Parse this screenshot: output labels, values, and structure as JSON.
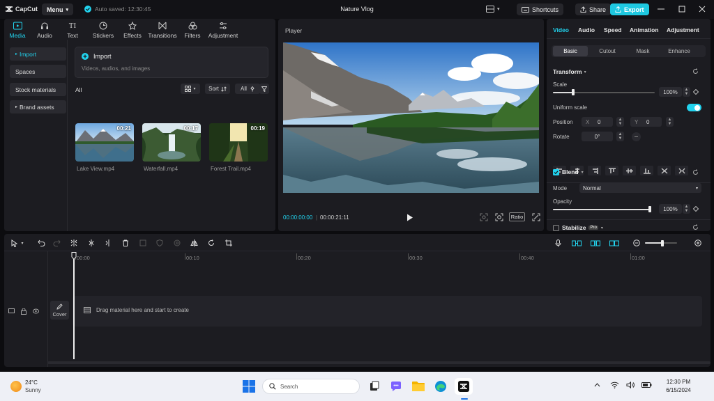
{
  "app": {
    "name": "CapCut",
    "menu_label": "Menu",
    "autosave": "Auto saved: 12:30:45",
    "project_title": "Nature Vlog",
    "shortcuts": "Shortcuts",
    "share": "Share",
    "export": "Export"
  },
  "media_tabs": [
    {
      "label": "Media",
      "icon": "media-icon"
    },
    {
      "label": "Audio",
      "icon": "audio-icon"
    },
    {
      "label": "Text",
      "icon": "text-icon"
    },
    {
      "label": "Stickers",
      "icon": "stickers-icon"
    },
    {
      "label": "Effects",
      "icon": "effects-icon"
    },
    {
      "label": "Transitions",
      "icon": "transitions-icon"
    },
    {
      "label": "Filters",
      "icon": "filters-icon"
    },
    {
      "label": "Adjustment",
      "icon": "adjustment-icon"
    }
  ],
  "media_sidebar": [
    "Import",
    "Spaces",
    "Stock materials",
    "Brand assets"
  ],
  "import_box": {
    "title": "Import",
    "subtitle": "Videos, audios, and images"
  },
  "media_filter": {
    "all_label": "All",
    "sort": "Sort",
    "all_dropdown": "All"
  },
  "media_items": [
    {
      "name": "Lake View.mp4",
      "duration": "00:21"
    },
    {
      "name": "Waterfall.mp4",
      "duration": "00:17"
    },
    {
      "name": "Forest Trail.mp4",
      "duration": "00:19"
    }
  ],
  "player": {
    "title": "Player",
    "current_time": "00:00:00:00",
    "total_time": "00:00:21:11",
    "ratio": "Ratio"
  },
  "inspector": {
    "tabs": [
      "Video",
      "Audio",
      "Speed",
      "Animation",
      "Adjustment"
    ],
    "subtabs": [
      "Basic",
      "Cutout",
      "Mask",
      "Enhance"
    ],
    "transform": "Transform",
    "scale_label": "Scale",
    "scale_value": "100%",
    "scale_fraction": 0.2,
    "uniform_scale": "Uniform scale",
    "position_label": "Position",
    "pos_x_label": "X",
    "pos_x": "0",
    "pos_y_label": "Y",
    "pos_y": "0",
    "rotate_label": "Rotate",
    "rotate_value": "0°",
    "blend": "Blend",
    "mode_label": "Mode",
    "mode_value": "Normal",
    "opacity_label": "Opacity",
    "opacity_value": "100%",
    "opacity_fraction": 1.0,
    "stabilize": "Stabilize",
    "pro_badge": "Pro"
  },
  "timeline": {
    "ticks": [
      "00:00",
      "00:10",
      "00:20",
      "00:30",
      "00:40",
      "01:00"
    ],
    "cover_label": "Cover",
    "drop_hint": "Drag material here and start to create",
    "zoom_fraction": 0.55
  },
  "taskbar": {
    "temp": "24°C",
    "weather": "Sunny",
    "search": "Search",
    "time": "12:30 PM",
    "date": "6/15/2024"
  },
  "colors": {
    "accent": "#22d3ee",
    "export_bg": "#1ec8e0",
    "panel": "#1c1c21",
    "taskbar": "#eef0f6"
  }
}
